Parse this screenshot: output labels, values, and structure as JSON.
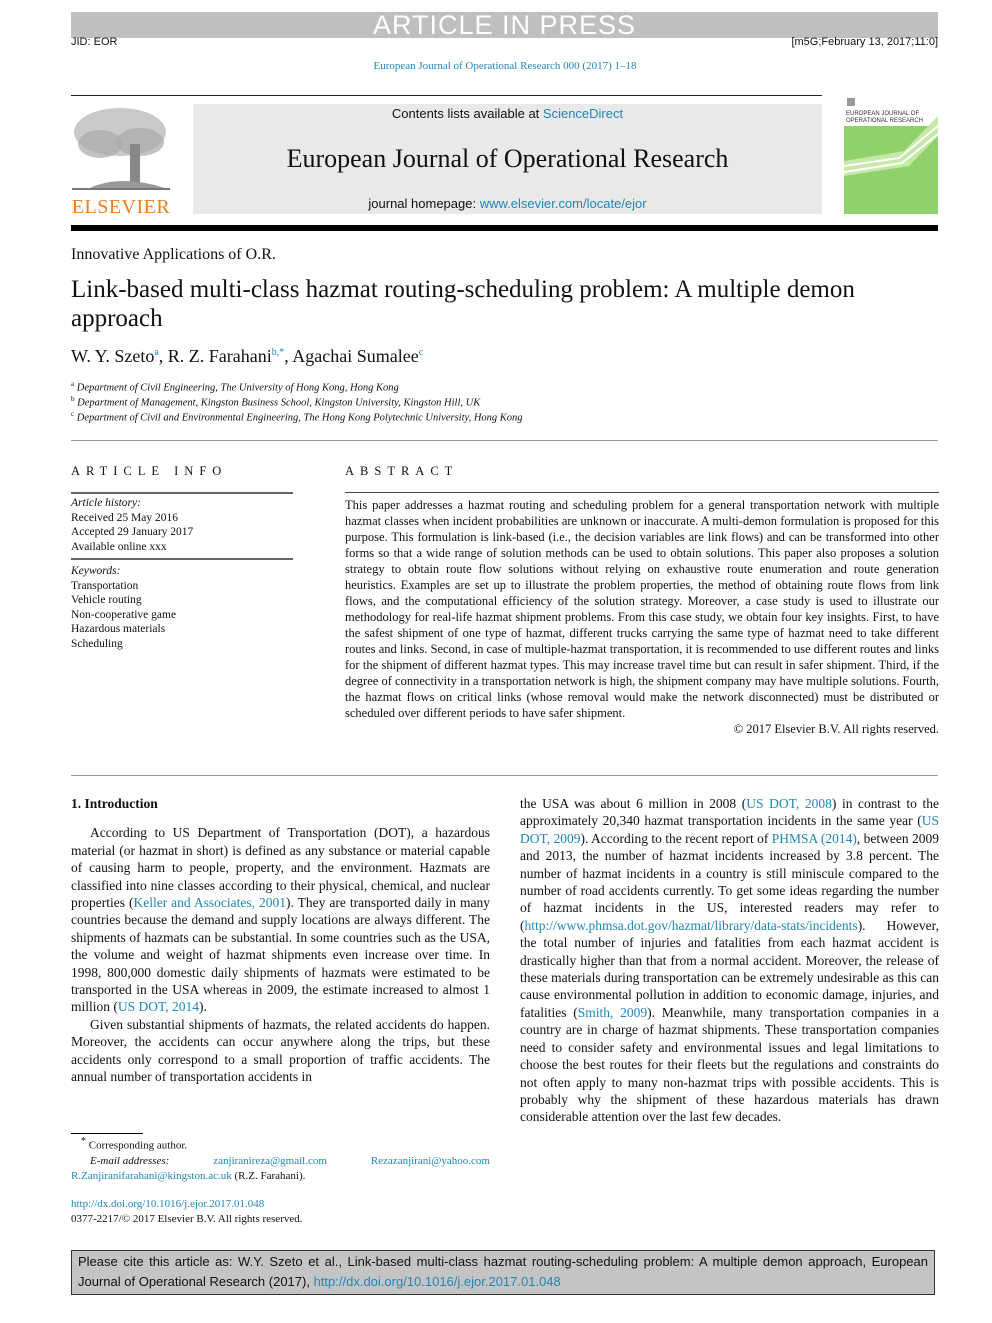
{
  "banner": {
    "text": "ARTICLE IN PRESS"
  },
  "header": {
    "jid": "JID: EOR",
    "stamp": "[m5G;February 13, 2017;11:0]",
    "journal_ref": "European Journal of Operational Research 000 (2017) 1–18"
  },
  "masthead": {
    "publisher": "ELSEVIER",
    "contents_prefix": "Contents lists available at ",
    "contents_link": "ScienceDirect",
    "journal_title": "European Journal of Operational Research",
    "homepage_prefix": "journal homepage: ",
    "homepage_link": "www.elsevier.com/locate/ejor",
    "cover_title_line1": "EUROPEAN JOURNAL OF",
    "cover_title_line2": "OPERATIONAL RESEARCH",
    "colors": {
      "link": "#1f86b8",
      "publisher": "#f07f1a",
      "cover": "#8fd16a"
    }
  },
  "article": {
    "section": "Innovative Applications of O.R.",
    "title": "Link-based multi-class hazmat routing-scheduling problem: A multiple demon approach",
    "authors": [
      {
        "name": "W. Y. Szeto",
        "mark": "a",
        "sep": ", "
      },
      {
        "name": "R. Z. Farahani",
        "mark": "b,*",
        "sep": ", "
      },
      {
        "name": "Agachai Sumalee",
        "mark": "c",
        "sep": ""
      }
    ],
    "affiliations": [
      {
        "mark": "a",
        "text": "Department of Civil Engineering, The University of Hong Kong, Hong Kong"
      },
      {
        "mark": "b",
        "text": "Department of Management, Kingston Business School, Kingston University, Kingston Hill, UK"
      },
      {
        "mark": "c",
        "text": "Department of Civil and Environmental Engineering, The Hong Kong Polytechnic University, Hong Kong"
      }
    ]
  },
  "article_info": {
    "heading": "ARTICLE INFO",
    "history_label": "Article history:",
    "history": [
      "Received 25 May 2016",
      "Accepted 29 January 2017",
      "Available online xxx"
    ],
    "keywords_label": "Keywords:",
    "keywords": [
      "Transportation",
      "Vehicle routing",
      "Non-cooperative game",
      "Hazardous materials",
      "Scheduling"
    ]
  },
  "abstract": {
    "heading": "ABSTRACT",
    "text": "This paper addresses a hazmat routing and scheduling problem for a general transportation network with multiple hazmat classes when incident probabilities are unknown or inaccurate. A multi-demon formulation is proposed for this purpose. This formulation is link-based (i.e., the decision variables are link flows) and can be transformed into other forms so that a wide range of solution methods can be used to obtain solutions. This paper also proposes a solution strategy to obtain route flow solutions without relying on exhaustive route enumeration and route generation heuristics. Examples are set up to illustrate the problem properties, the method of obtaining route flows from link flows, and the computational efficiency of the solution strategy. Moreover, a case study is used to illustrate our methodology for real-life hazmat shipment problems. From this case study, we obtain four key insights. First, to have the safest shipment of one type of hazmat, different trucks carrying the same type of hazmat need to take different routes and links. Second, in case of multiple-hazmat transportation, it is recommended to use different routes and links for the shipment of different hazmat types. This may increase travel time but can result in safer shipment. Third, if the degree of connectivity in a transportation network is high, the shipment company may have multiple solutions. Fourth, the hazmat flows on critical links (whose removal would make the network disconnected) must be distributed or scheduled over different periods to have safer shipment.",
    "copyright": "© 2017 Elsevier B.V. All rights reserved."
  },
  "body": {
    "section_heading": "1.  Introduction",
    "p1_a": "According to US Department of Transportation (DOT), a hazardous material (or hazmat in short) is defined as any substance or material capable of causing harm to people, property, and the environment. Hazmats are classified into nine classes according to their physical, chemical, and nuclear properties (",
    "p1_cite1": "Keller and Associates, 2001",
    "p1_b": "). They are transported daily in many countries because the demand and supply locations are always different. The shipments of hazmats can be substantial. In some countries such as the USA, the volume and weight of hazmat shipments even increase over time. In 1998, 800,000 domestic daily shipments of hazmats were estimated to be transported in the USA whereas in 2009, the estimate increased to almost 1 million (",
    "p1_cite2": "US DOT, 2014",
    "p1_c": ").",
    "p2_a": "Given substantial shipments of hazmats, the related accidents do happen. Moreover, the accidents can occur anywhere along the trips, but these accidents only correspond to a small proportion of traffic accidents. The annual number of transportation accidents in",
    "r_a": "the USA was about 6 million in 2008 (",
    "r_cite1": "US DOT, 2008",
    "r_b": ") in contrast to the approximately 20,340 hazmat transportation incidents in the same year (",
    "r_cite2": "US DOT, 2009",
    "r_c": "). According to the recent report of ",
    "r_cite3": "PHMSA (2014)",
    "r_d": ", between 2009 and 2013, the number of hazmat incidents increased by 3.8 percent. The number of hazmat incidents in a country is still miniscule compared to the number of road accidents currently. To get some ideas regarding the number of hazmat incidents in the US, interested readers may refer to (",
    "r_url": "http://www.phmsa.dot.gov/hazmat/library/data-stats/incidents",
    "r_e": "). However, the total number of injuries and fatalities from each hazmat accident is drastically higher than that from a normal accident. Moreover, the release of these materials during transportation can be extremely undesirable as this can cause environmental pollution in addition to economic damage, injuries, and fatalities (",
    "r_cite4": "Smith, 2009",
    "r_f": "). Meanwhile, many transportation companies in a country are in charge of hazmat shipments. These transportation companies need to consider safety and environmental issues and legal limitations to choose the best routes for their fleets but the regulations and constraints do not often apply to many non-hazmat trips with possible accidents. This is probably why the shipment of these hazardous materials has drawn considerable attention over the last few decades."
  },
  "footnote": {
    "mark": "*",
    "corresponding": "Corresponding author.",
    "email_label": "E-mail addresses:",
    "emails": [
      "zanjiranireza@gmail.com",
      "Rezazanjirani@yahoo.com",
      "R.Zanjiranifarahani@kingston.ac.uk"
    ],
    "email_owner": "(R.Z. Farahani)."
  },
  "doi": {
    "url": "http://dx.doi.org/10.1016/j.ejor.2017.01.048",
    "issn": "0377-2217/© 2017 Elsevier B.V. All rights reserved."
  },
  "cite_box": {
    "text": "Please cite this article as: W.Y. Szeto et al., Link-based multi-class hazmat routing-scheduling problem: A multiple demon approach, European Journal of Operational Research (2017), ",
    "url": "http://dx.doi.org/10.1016/j.ejor.2017.01.048"
  }
}
